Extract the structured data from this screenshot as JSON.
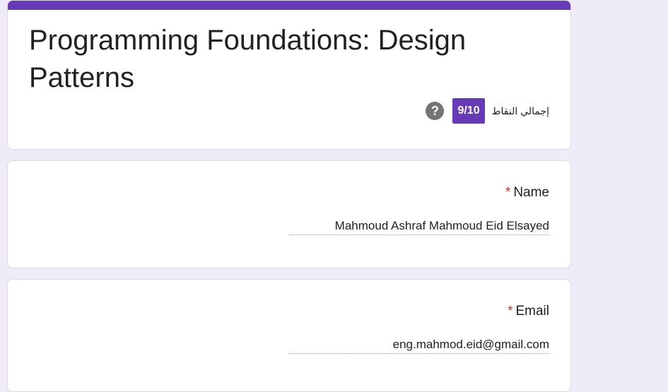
{
  "form": {
    "title": "Programming Foundations: Design Patterns",
    "accent_color": "#673ab7",
    "score": {
      "label": "إجمالي النقاط",
      "value": "9/10"
    },
    "help_icon": "question-mark-icon",
    "help_glyph": "?"
  },
  "questions": [
    {
      "label": "Name",
      "required_mark": "*",
      "answer": "Mahmoud Ashraf Mahmoud Eid Elsayed"
    },
    {
      "label": "Email",
      "required_mark": "*",
      "answer": "eng.mahmod.eid@gmail.com"
    }
  ]
}
